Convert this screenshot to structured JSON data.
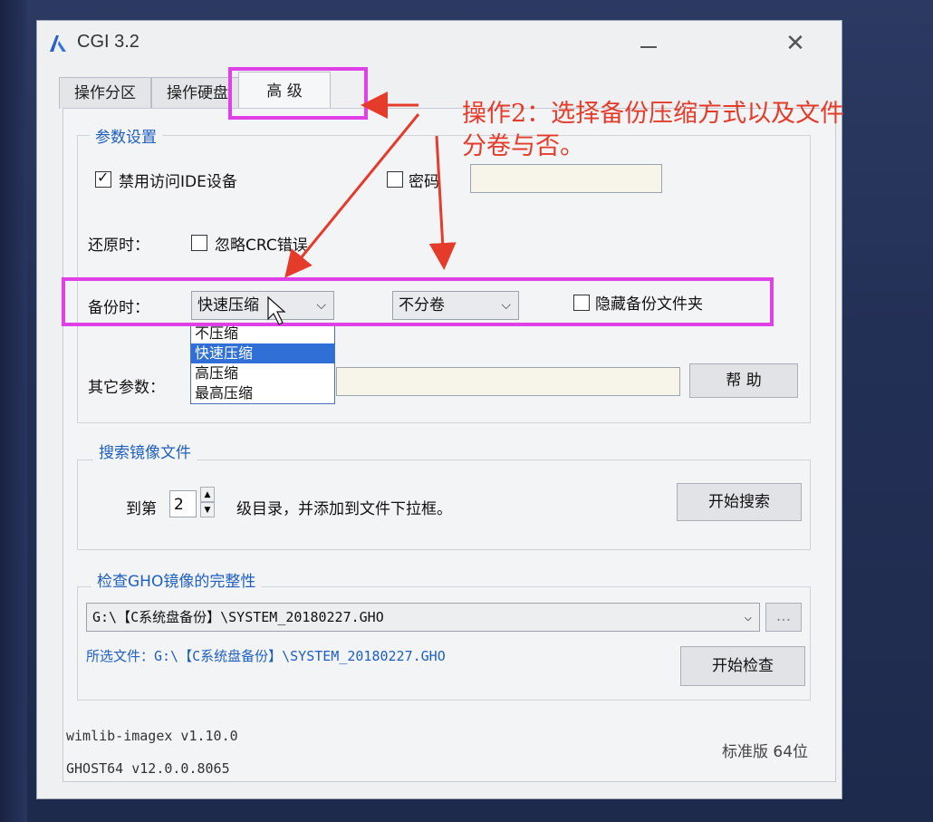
{
  "window": {
    "title": "CGI 3.2",
    "close_glyph": "✕"
  },
  "tabs": [
    {
      "label": "操作分区"
    },
    {
      "label": "操作硬盘"
    },
    {
      "label": "高 级"
    }
  ],
  "params": {
    "group_title": "参数设置",
    "disable_ide": "禁用访问IDE设备",
    "password_label": "密码",
    "restore_label": "还原时：",
    "ignore_crc": "忽略CRC错误",
    "backup_label": "备份时：",
    "compression_selected": "快速压缩",
    "compression_options": [
      "不压缩",
      "快速压缩",
      "高压缩",
      "最高压缩"
    ],
    "split_selected": "不分卷",
    "hide_folder": "隐藏备份文件夹",
    "other_label": "其它参数：",
    "help_button": "帮 助"
  },
  "search": {
    "group_title": "搜索镜像文件",
    "prefix": "到第",
    "level": "2",
    "suffix": "级目录，并添加到文件下拉框。",
    "start_button": "开始搜索"
  },
  "check": {
    "group_title": "检查GHO镜像的完整性",
    "path": "G:\\【C系统盘备份】\\SYSTEM_20180227.GHO",
    "browse": "...",
    "selected_file": "所选文件：G:\\【C系统盘备份】\\SYSTEM_20180227.GHO",
    "start_button": "开始检查"
  },
  "footer": {
    "wimlib": "wimlib-imagex v1.10.0",
    "ghost": "GHOST64 v12.0.0.8065",
    "edition": "标准版 64位"
  },
  "annotation": {
    "line1": "操作2：选择备份压缩方式以及文件",
    "line2": "分卷与否。"
  },
  "colors": {
    "highlight": "#e040e8",
    "annotation": "#e53b2b",
    "link": "#1f5fbf"
  }
}
